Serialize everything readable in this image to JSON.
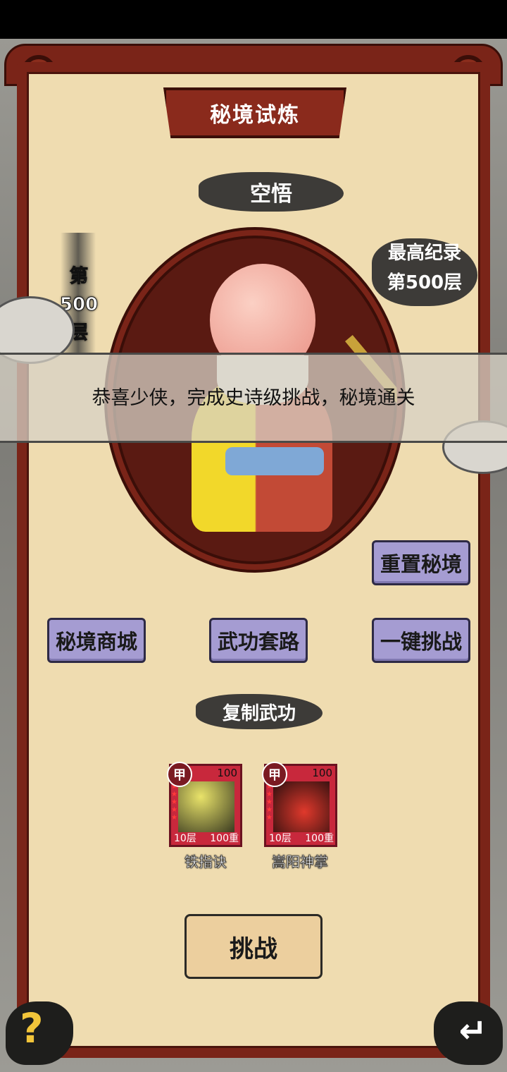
{
  "header": {
    "title": "秘境试炼"
  },
  "boss": {
    "name": "空悟"
  },
  "floor": {
    "prefix": "第",
    "number": "500",
    "suffix": "层"
  },
  "record": {
    "label": "最高纪录",
    "value": "第500层"
  },
  "notice": {
    "text": "恭喜少侠，完成史诗级挑战，秘境通关"
  },
  "buttons": {
    "reset": "重置秘境",
    "shop": "秘境商城",
    "routine": "武功套路",
    "auto": "一键挑战",
    "challenge": "挑战"
  },
  "skills": {
    "title": "复制武功",
    "items": [
      {
        "grade": "甲",
        "level": "100",
        "layer": "10层",
        "weight": "100重",
        "name": "铁指诀"
      },
      {
        "grade": "甲",
        "level": "100",
        "layer": "10层",
        "weight": "100重",
        "name": "嵩阳神掌"
      }
    ]
  },
  "corner": {
    "help": "?",
    "back_icon": "return-arrow-icon"
  }
}
